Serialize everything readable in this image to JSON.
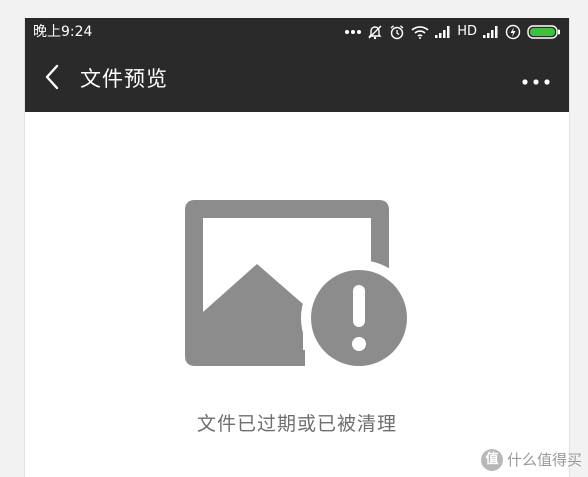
{
  "status_bar": {
    "time": "晚上9:24",
    "network_label": "HD",
    "icons": [
      "more-dots-icon",
      "mute-icon",
      "alarm-icon",
      "wifi-icon",
      "signal-icon",
      "hd-label",
      "signal-icon",
      "charging-icon",
      "battery-icon"
    ],
    "battery_color": "#3fbf3f"
  },
  "header": {
    "title": "文件预览",
    "back_icon": "chevron-left-icon",
    "more_icon": "more-dots-icon",
    "background": "#2a2a2a"
  },
  "main": {
    "illustration_icon": "image-expired-icon",
    "message": "文件已过期或已被清理",
    "icon_color": "#8c8c8c"
  },
  "watermark": {
    "logo_text": "值",
    "text": "什么值得买"
  }
}
